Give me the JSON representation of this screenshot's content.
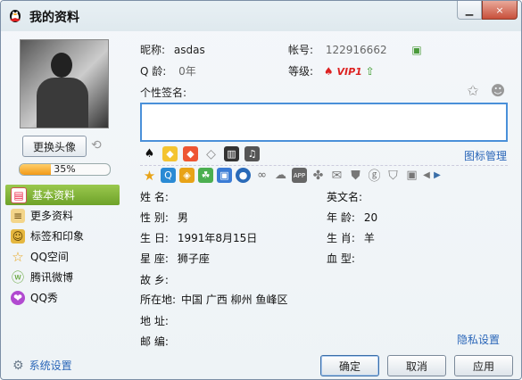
{
  "window": {
    "title": "我的资料",
    "min_icon": "minimize-icon",
    "close_label": "×"
  },
  "profile": {
    "change_avatar": "更换头像",
    "completion_percent": 35,
    "completion_text": "35%",
    "nickname_label": "昵称:",
    "nickname": "asdas",
    "account_label": "帐号:",
    "account": "122916662",
    "age_label": "Q 龄:",
    "age": "0年",
    "level_label": "等级:",
    "vip": "VIP1",
    "signature_label": "个性签名:",
    "signature": "",
    "icon_manage": "图标管理",
    "privacy": "隐私设置"
  },
  "nav": [
    {
      "label": "基本资料",
      "active": true
    },
    {
      "label": "更多资料",
      "active": false
    },
    {
      "label": "标签和印象",
      "active": false
    },
    {
      "label": "QQ空间",
      "active": false
    },
    {
      "label": "腾讯微博",
      "active": false
    },
    {
      "label": "QQ秀",
      "active": false
    }
  ],
  "fields": {
    "name_label": "姓 名:",
    "name": "",
    "eng_name_label": "英文名:",
    "eng_name": "",
    "gender_label": "性 别:",
    "gender": "男",
    "age_label": "年 龄:",
    "age": "20",
    "birthday_label": "生 日:",
    "birthday": "1991年8月15日",
    "zodiac_animal_label": "生 肖:",
    "zodiac_animal": "羊",
    "constellation_label": "星 座:",
    "constellation": "狮子座",
    "blood_label": "血 型:",
    "blood": "",
    "hometown_label": "故 乡:",
    "hometown": "",
    "location_label": "所在地:",
    "location": "中国  广西  柳州  鱼峰区",
    "address_label": "地 址:",
    "address": "",
    "zip_label": "邮 编:",
    "zip": ""
  },
  "footer": {
    "settings": "系统设置",
    "ok": "确定",
    "cancel": "取消",
    "apply": "应用"
  },
  "colors": {
    "accent_blue": "#2a66b8",
    "nav_active": "#7fb53a",
    "signature_border": "#4a90d9"
  }
}
